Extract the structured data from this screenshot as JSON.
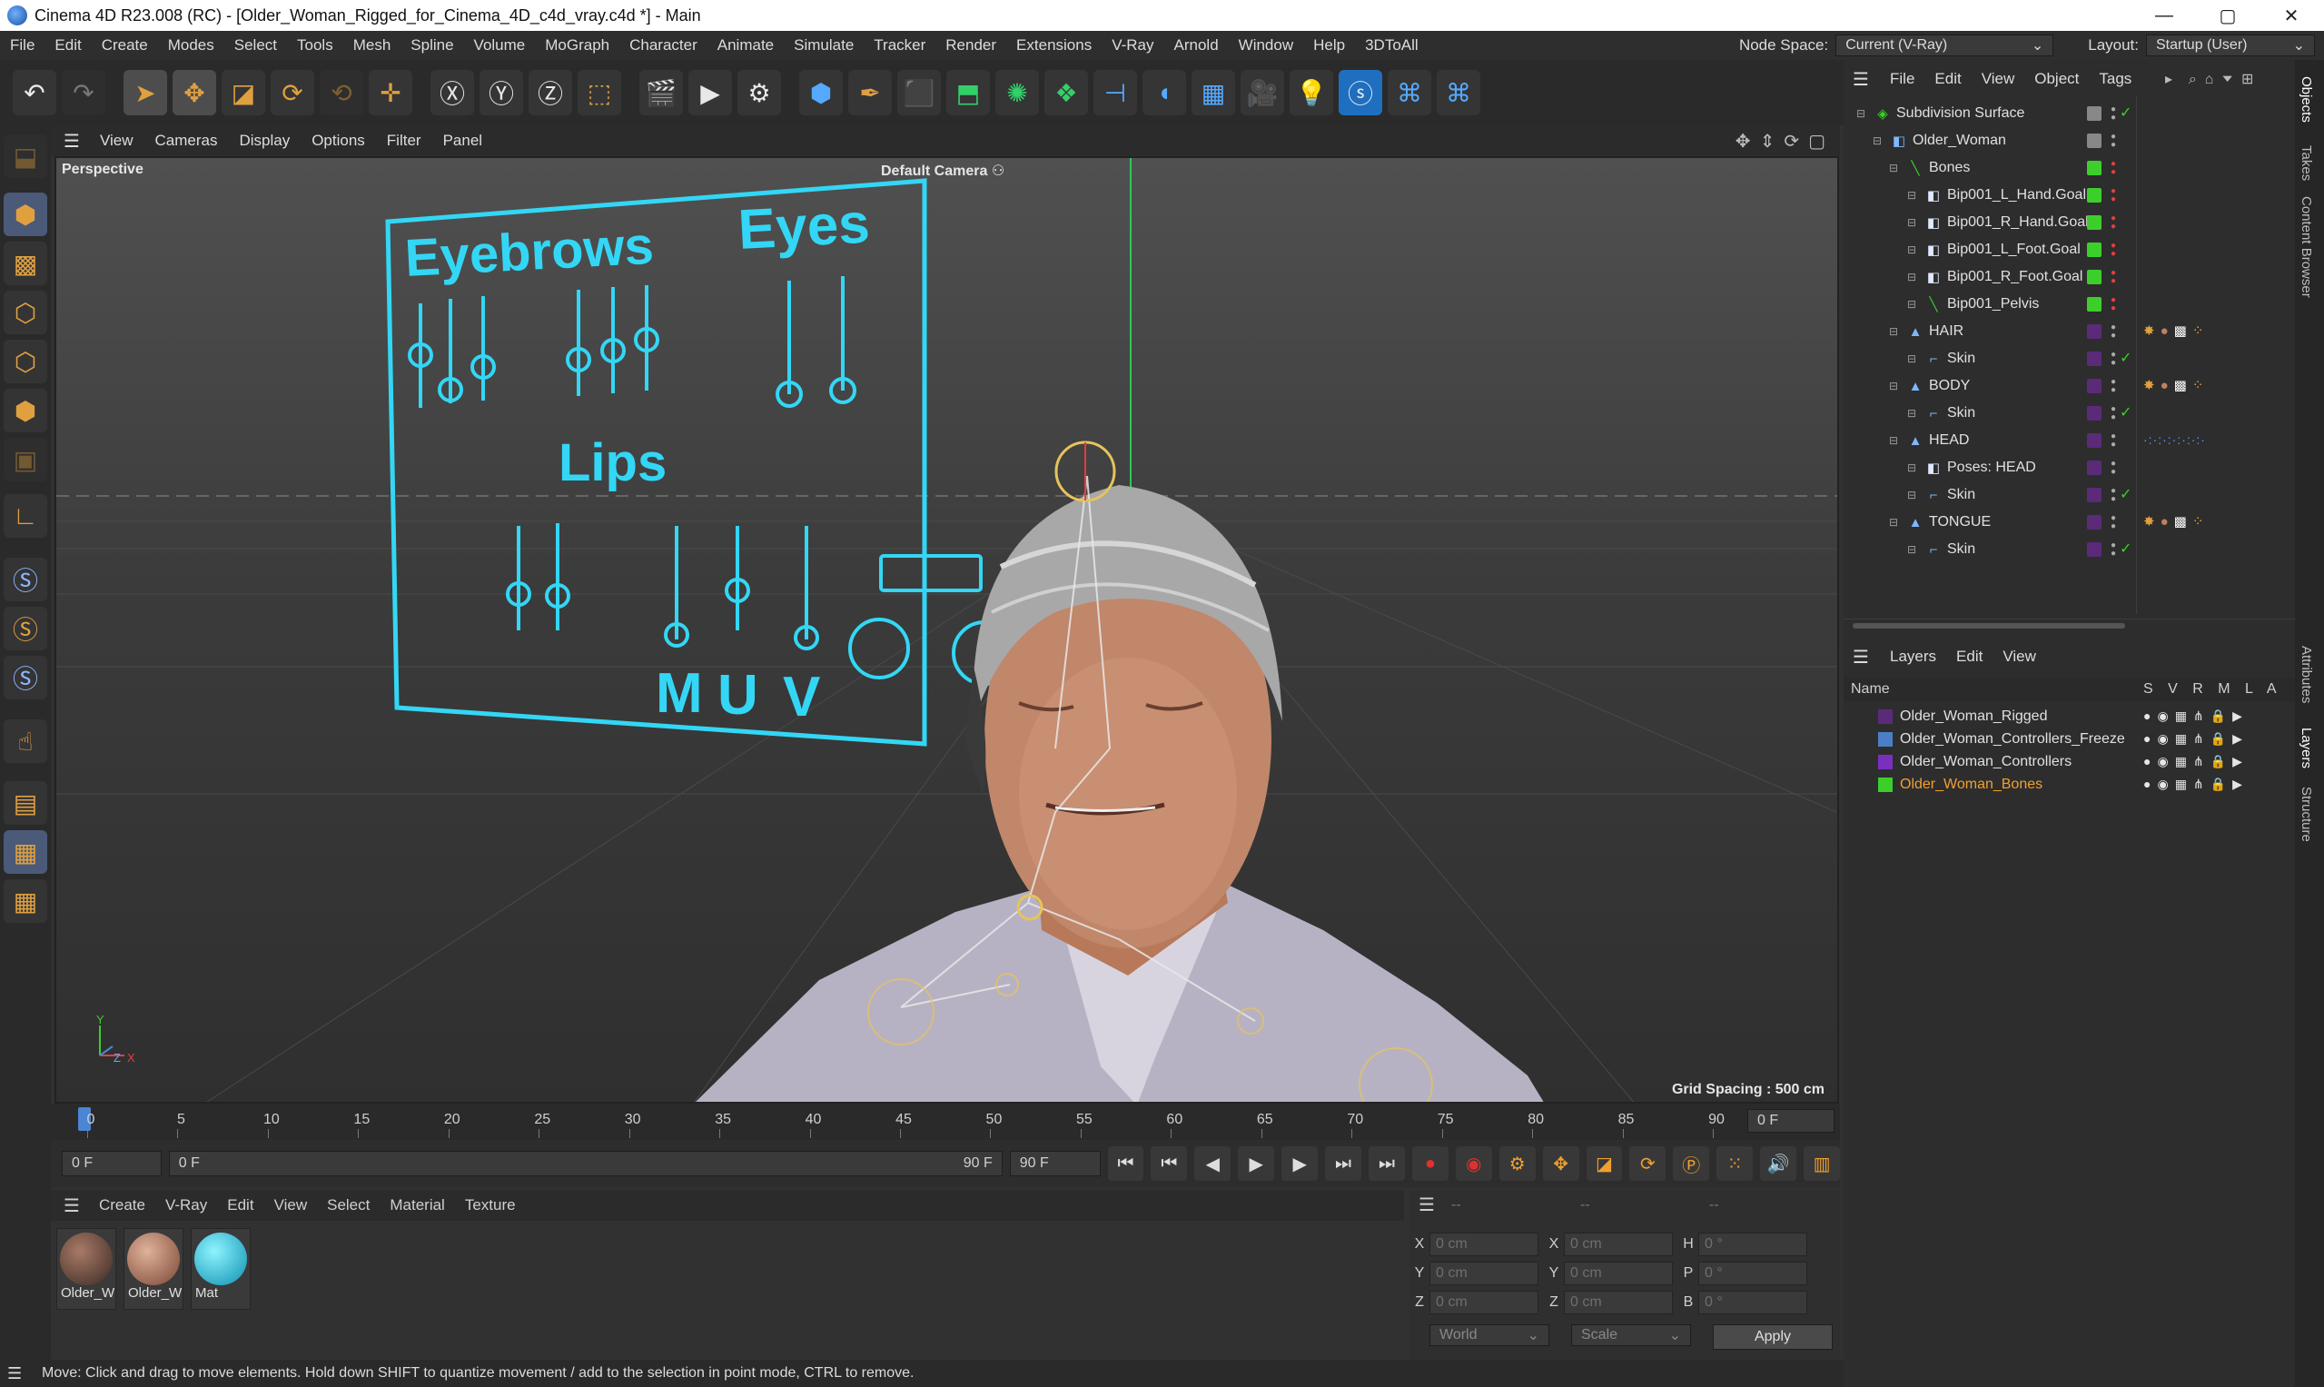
{
  "window": {
    "title": "Cinema 4D R23.008 (RC) - [Older_Woman_Rigged_for_Cinema_4D_c4d_vray.c4d *] - Main",
    "minimize": "—",
    "maximize": "▢",
    "close": "✕"
  },
  "menubar": {
    "items": [
      "File",
      "Edit",
      "Create",
      "Modes",
      "Select",
      "Tools",
      "Mesh",
      "Spline",
      "Volume",
      "MoGraph",
      "Character",
      "Animate",
      "Simulate",
      "Tracker",
      "Render",
      "Extensions",
      "V-Ray",
      "Arnold",
      "Window",
      "Help",
      "3DToAll"
    ],
    "node_space_label": "Node Space:",
    "node_space_value": "Current (V-Ray)",
    "layout_label": "Layout:",
    "layout_value": "Startup (User)"
  },
  "viewport": {
    "menu": [
      "View",
      "Cameras",
      "Display",
      "Options",
      "Filter",
      "Panel"
    ],
    "view_name": "Perspective",
    "camera": "Default Camera",
    "grid_spacing": "Grid Spacing : 500 cm",
    "axis_y": "Y",
    "axis_z": "Z",
    "axis_x": "X",
    "panel": {
      "eyebrows": "Eyebrows",
      "eyes": "Eyes",
      "lips": "Lips",
      "m": "M",
      "u": "U",
      "v": "V"
    }
  },
  "timeline": {
    "ticks": [
      "0",
      "5",
      "10",
      "15",
      "20",
      "25",
      "30",
      "35",
      "40",
      "45",
      "50",
      "55",
      "60",
      "65",
      "70",
      "75",
      "80",
      "85",
      "90"
    ],
    "current_frame": "0 F",
    "start": "0 F",
    "range_start": "0 F",
    "range_end": "90 F",
    "end": "90 F"
  },
  "materials": {
    "menu": [
      "Create",
      "V-Ray",
      "Edit",
      "View",
      "Select",
      "Material",
      "Texture"
    ],
    "items": [
      {
        "label": "Older_W"
      },
      {
        "label": "Older_W"
      },
      {
        "label": "Mat"
      }
    ]
  },
  "coordinates": {
    "header_left": "--",
    "header_mid": "--",
    "header_right": "--",
    "rows": [
      {
        "l1": "X",
        "v1": "0 cm",
        "l2": "X",
        "v2": "0 cm",
        "l3": "H",
        "v3": "0 °"
      },
      {
        "l1": "Y",
        "v1": "0 cm",
        "l2": "Y",
        "v2": "0 cm",
        "l3": "P",
        "v3": "0 °"
      },
      {
        "l1": "Z",
        "v1": "0 cm",
        "l2": "Z",
        "v2": "0 cm",
        "l3": "B",
        "v3": "0 °"
      }
    ],
    "mode": "World",
    "scale": "Scale",
    "apply": "Apply"
  },
  "status": {
    "text": "Move: Click and drag to move elements. Hold down SHIFT to quantize movement / add to the selection in point mode, CTRL to remove."
  },
  "objects": {
    "menu": [
      "File",
      "Edit",
      "View",
      "Object",
      "Tags"
    ],
    "rows": [
      {
        "name": "Subdivision Surface"
      },
      {
        "name": "Older_Woman"
      },
      {
        "name": "Bones"
      },
      {
        "name": "Bip001_L_Hand.Goal"
      },
      {
        "name": "Bip001_R_Hand.Goal"
      },
      {
        "name": "Bip001_L_Foot.Goal"
      },
      {
        "name": "Bip001_R_Foot.Goal"
      },
      {
        "name": "Bip001_Pelvis"
      },
      {
        "name": "HAIR"
      },
      {
        "name": "Skin"
      },
      {
        "name": "BODY"
      },
      {
        "name": "Skin"
      },
      {
        "name": "HEAD"
      },
      {
        "name": "Poses: HEAD"
      },
      {
        "name": "Skin"
      },
      {
        "name": "TONGUE"
      },
      {
        "name": "Skin"
      }
    ]
  },
  "layers": {
    "menu": [
      "Layers",
      "Edit",
      "View"
    ],
    "header_name": "Name",
    "header_cols": "S V R M L A",
    "rows": [
      {
        "name": "Older_Woman_Rigged",
        "color": "#5b2a78"
      },
      {
        "name": "Older_Woman_Controllers_Freeze",
        "color": "#4a7fc6"
      },
      {
        "name": "Older_Woman_Controllers",
        "color": "#7a2fbf"
      },
      {
        "name": "Older_Woman_Bones",
        "color": "#3ccf2b"
      }
    ]
  },
  "side_tabs": [
    "Objects",
    "Takes",
    "Content Browser",
    "Attributes",
    "Layers",
    "Structure"
  ],
  "colors": {
    "accent_cyan": "#33d7f5",
    "selection_orange": "#f0a030",
    "timeline_blue": "#4a86d4"
  }
}
